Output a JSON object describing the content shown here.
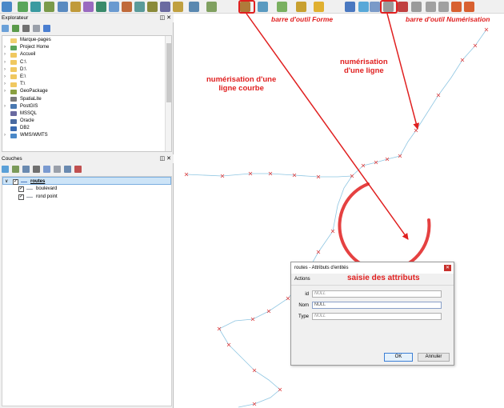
{
  "colors": {
    "accent_red": "#e02020",
    "line_blue": "#8fc6e2",
    "vertex_red": "#e04040",
    "selection_blue": "#cde4f7"
  },
  "toolbar": {
    "icons": [
      "new-project",
      "open-project",
      "save-project",
      "add-vector-layer",
      "add-raster-layer",
      "add-csv-layer",
      "add-postgis-layer",
      "add-spatialite-layer",
      "add-wms-layer",
      "add-wfs-layer",
      "add-virtual-layer",
      "add-mesh-layer",
      "add-plugin",
      "identify",
      "select-feature",
      "add-circular-string",
      "add-ring",
      "add-polygon",
      "add-point-shape",
      "toggle-editing",
      "edit-pencil",
      "save-edits",
      "add-line-feature",
      "vertex-tool",
      "modify-attributes",
      "delete-selected",
      "cut-features",
      "copy-features",
      "paste-features",
      "undo",
      "redo"
    ]
  },
  "browser_panel": {
    "title": "Explorateur",
    "items": [
      {
        "label": "Marque-pages",
        "expandable": false,
        "icon": "star-icon"
      },
      {
        "label": "Project Home",
        "expandable": true,
        "icon": "home-icon"
      },
      {
        "label": "Accueil",
        "expandable": true,
        "icon": "folder-icon"
      },
      {
        "label": "C:\\",
        "expandable": true,
        "icon": "folder-icon"
      },
      {
        "label": "D:\\",
        "expandable": true,
        "icon": "folder-icon"
      },
      {
        "label": "E:\\",
        "expandable": true,
        "icon": "folder-icon"
      },
      {
        "label": "T:\\",
        "expandable": true,
        "icon": "folder-icon"
      },
      {
        "label": "GeoPackage",
        "expandable": true,
        "icon": "geopackage-icon"
      },
      {
        "label": "SpatiaLite",
        "expandable": false,
        "icon": "spatialite-icon"
      },
      {
        "label": "PostGIS",
        "expandable": true,
        "icon": "postgis-icon"
      },
      {
        "label": "MSSQL",
        "expandable": false,
        "icon": "mssql-icon"
      },
      {
        "label": "Oracle",
        "expandable": false,
        "icon": "oracle-icon"
      },
      {
        "label": "DB2",
        "expandable": false,
        "icon": "db2-icon"
      },
      {
        "label": "WMS/WMTS",
        "expandable": true,
        "icon": "wms-icon"
      }
    ]
  },
  "layers_panel": {
    "title": "Couches",
    "layers": [
      {
        "label": "routes",
        "checked": true,
        "selected": true
      },
      {
        "label": "boulevard",
        "checked": true,
        "selected": false
      },
      {
        "label": "rond point",
        "checked": true,
        "selected": false
      }
    ]
  },
  "annotations": {
    "forme_toolbar": "barre d'outil Forme",
    "numerisation_toolbar": "barre d'outil Numérisation",
    "line_digitizing": "numérisation\nd'une ligne",
    "curve_digitizing": "numérisation d'une\nligne courbe",
    "attributes_entry": "saisie des attributs"
  },
  "dialog": {
    "title": "routes - Attributs d'entités",
    "tab": "Actions",
    "fields": [
      {
        "label": "id",
        "value": "NULL",
        "placeholder": true
      },
      {
        "label": "Nom",
        "value": "NULL",
        "placeholder": false
      },
      {
        "label": "Type",
        "value": "NULL",
        "placeholder": true
      }
    ],
    "ok_label": "OK",
    "cancel_label": "Annuler"
  }
}
